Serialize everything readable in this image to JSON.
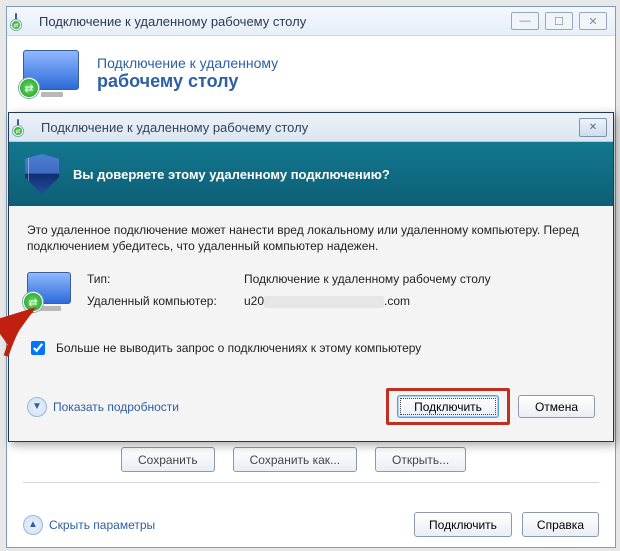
{
  "bg_window": {
    "title": "Подключение к удаленному рабочему столу",
    "hero_line1": "Подключение к удаленному",
    "hero_line2": "рабочему столу",
    "buttons": {
      "save": "Сохранить",
      "save_as": "Сохранить как...",
      "open": "Открыть..."
    },
    "footer": {
      "hide_params": "Скрыть параметры",
      "connect": "Подключить",
      "help": "Справка"
    }
  },
  "dialog": {
    "title": "Подключение к удаленному рабочему столу",
    "question": "Вы доверяете этому удаленному подключению?",
    "description": "Это удаленное подключение может нанести вред локальному или удаленному компьютеру. Перед подключением убедитесь, что удаленный компьютер надежен.",
    "type_label": "Тип:",
    "type_value": "Подключение к удаленному рабочему столу",
    "host_label": "Удаленный компьютер:",
    "host_prefix": "u20",
    "host_suffix": ".com",
    "checkbox_label": "Больше не выводить запрос о подключениях к этому компьютеру",
    "checkbox_checked": true,
    "show_details": "Показать подробности",
    "connect": "Подключить",
    "cancel": "Отмена"
  }
}
